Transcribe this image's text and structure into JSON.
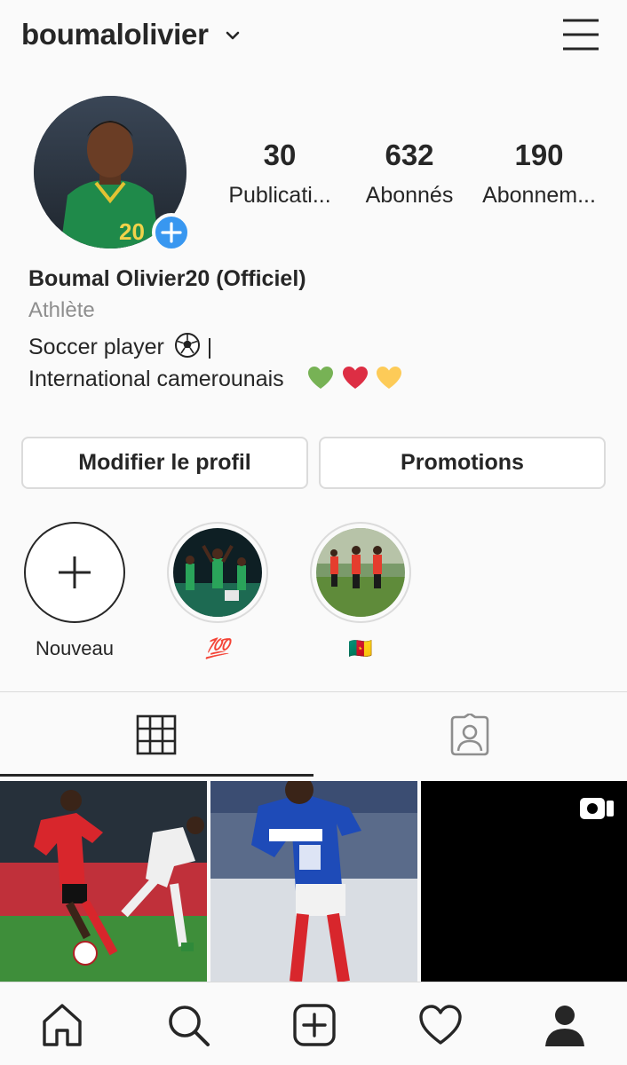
{
  "header": {
    "username": "boumalolivier",
    "dropdown_icon": "chevron-down-icon",
    "menu_icon": "hamburger-menu-icon"
  },
  "profile": {
    "stats": [
      {
        "value": "30",
        "label": "Publicati..."
      },
      {
        "value": "632",
        "label": "Abonnés"
      },
      {
        "value": "190",
        "label": "Abonnem..."
      }
    ],
    "display_name": "Boumal Olivier20 (Officiel)",
    "category": "Athlète",
    "bio_line1": "Soccer player",
    "bio_line1_suffix": "|",
    "bio_line2": "International camerounais"
  },
  "actions": {
    "edit_label": "Modifier le profil",
    "promo_label": "Promotions"
  },
  "highlights": [
    {
      "label": "Nouveau"
    },
    {
      "label": "💯"
    },
    {
      "label": "🇨🇲"
    }
  ],
  "colors": {
    "accent": "#3897f0",
    "text": "#262626",
    "muted": "#8e8e8e",
    "border": "#dbdbdb"
  }
}
